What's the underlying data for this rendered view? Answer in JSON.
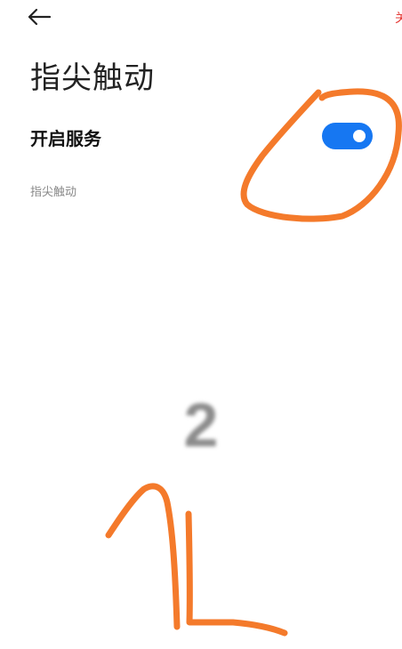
{
  "header": {
    "back_icon": "arrow-left-icon",
    "edge_text": "关"
  },
  "page": {
    "title": "指尖触动"
  },
  "service": {
    "label": "开启服务",
    "toggle_state": "on",
    "description": "指尖触动"
  },
  "overlay": {
    "countdown": "2"
  },
  "colors": {
    "toggle_on": "#1677f2",
    "annotation": "#f47a2b",
    "countdown": "#8c8c8c"
  }
}
